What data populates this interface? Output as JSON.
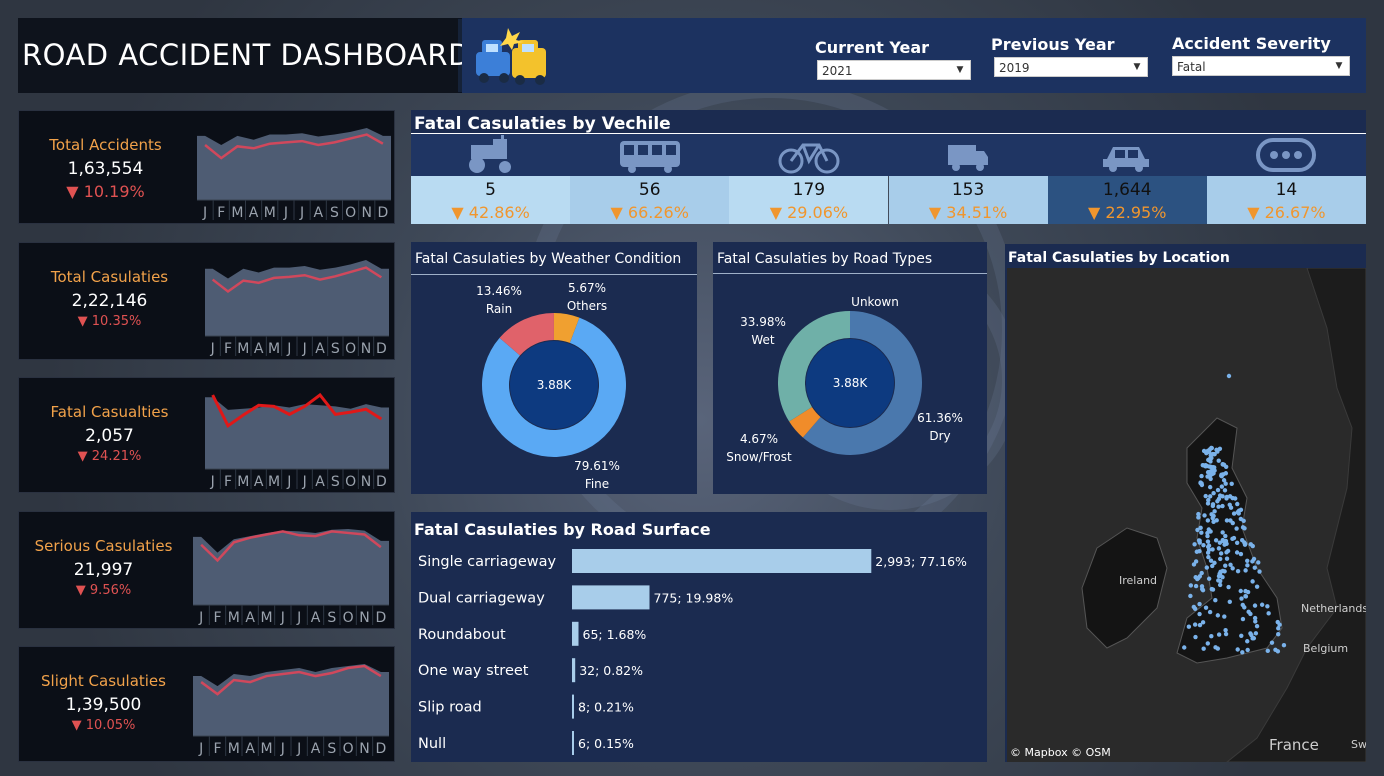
{
  "header": {
    "title": "ROAD ACCIDENT DASHBOARD",
    "filters": [
      {
        "label": "Current Year",
        "value": "2021"
      },
      {
        "label": "Previous Year",
        "value": "2019"
      },
      {
        "label": "Accident Severity",
        "value": "Fatal"
      }
    ]
  },
  "kpis": [
    {
      "label": "Total Accidents",
      "value": "1,63,554",
      "delta": "▼ 10.19%"
    },
    {
      "label": "Total Casulaties",
      "value": "2,22,146",
      "delta": "▼ 10.35%"
    },
    {
      "label": "Fatal Casualties",
      "value": "2,057",
      "delta": "▼ 24.21%"
    },
    {
      "label": "Serious Casulaties",
      "value": "21,997",
      "delta": "▼ 9.56%"
    },
    {
      "label": "Slight Casulaties",
      "value": "1,39,500",
      "delta": "▼ 10.05%"
    }
  ],
  "months": [
    "J",
    "F",
    "M",
    "A",
    "M",
    "J",
    "J",
    "A",
    "S",
    "O",
    "N",
    "D"
  ],
  "vehicle": {
    "title": "Fatal Casulaties by Vechile",
    "items": [
      {
        "icon": "tractor-icon",
        "value": "5",
        "delta": "▼ 42.86%"
      },
      {
        "icon": "bus-icon",
        "value": "56",
        "delta": "▼ 66.26%"
      },
      {
        "icon": "bicycle-icon",
        "value": "179",
        "delta": "▼ 29.06%"
      },
      {
        "icon": "van-icon",
        "value": "153",
        "delta": "▼ 34.51%"
      },
      {
        "icon": "car-icon",
        "value": "1,644",
        "delta": "▼ 22.95%"
      },
      {
        "icon": "other-icon",
        "value": "14",
        "delta": "▼ 26.67%"
      }
    ]
  },
  "weather": {
    "title": "Fatal Casulaties by Weather Condition",
    "center": "3.88K",
    "labels": [
      {
        "pct": "13.46%",
        "name": "Rain"
      },
      {
        "pct": "5.67%",
        "name": "Others"
      },
      {
        "pct": "79.61%",
        "name": "Fine"
      }
    ]
  },
  "road_types": {
    "title": "Fatal Casulaties by Road Types",
    "center": "3.88K",
    "labels": [
      {
        "pct": "",
        "name": "Unkown"
      },
      {
        "pct": "33.98%",
        "name": "Wet"
      },
      {
        "pct": "61.36%",
        "name": "Dry"
      },
      {
        "pct": "4.67%",
        "name": "Snow/Frost"
      }
    ]
  },
  "location": {
    "title": "Fatal Casulaties by Location",
    "map_labels": {
      "ireland": "Ireland",
      "netherlands": "Netherlands",
      "belgium": "Belgium",
      "france": "France",
      "sw": "Sw"
    },
    "credit": "© Mapbox © OSM"
  },
  "surface": {
    "title": "Fatal  Casulaties by Road Surface"
  },
  "chart_data": [
    {
      "type": "area",
      "title": "Total Accidents",
      "x": [
        "J",
        "F",
        "M",
        "A",
        "M",
        "J",
        "J",
        "A",
        "S",
        "O",
        "N",
        "D"
      ],
      "series": [
        {
          "name": "Current Year",
          "values": [
            13.0,
            11.0,
            12.8,
            12.5,
            13.2,
            13.4,
            13.6,
            13.0,
            13.4,
            14.0,
            14.6,
            13.2
          ]
        },
        {
          "name": "Previous Year",
          "values": [
            14.4,
            13.0,
            14.4,
            13.8,
            14.6,
            14.6,
            14.8,
            14.3,
            14.6,
            15.0,
            15.6,
            14.4
          ]
        }
      ]
    },
    {
      "type": "area",
      "title": "Total Casulaties",
      "x": [
        "J",
        "F",
        "M",
        "A",
        "M",
        "J",
        "J",
        "A",
        "S",
        "O",
        "N",
        "D"
      ],
      "series": [
        {
          "name": "Current Year",
          "values": [
            17.6,
            15.4,
            17.4,
            17.0,
            17.9,
            18.1,
            18.4,
            17.6,
            18.2,
            19.0,
            19.8,
            18.0
          ]
        },
        {
          "name": "Previous Year",
          "values": [
            19.6,
            17.8,
            19.6,
            18.9,
            19.8,
            19.8,
            20.1,
            19.4,
            19.8,
            20.4,
            21.2,
            19.6
          ]
        }
      ]
    },
    {
      "type": "area",
      "title": "Fatal Casualties",
      "x": [
        "J",
        "F",
        "M",
        "A",
        "M",
        "J",
        "J",
        "A",
        "S",
        "O",
        "N",
        "D"
      ],
      "series": [
        {
          "name": "Current Year",
          "values": [
            230,
            176,
            195,
            212,
            210,
            196,
            210,
            230,
            196,
            200,
            205,
            188
          ]
        },
        {
          "name": "Previous Year",
          "values": [
            226,
            204,
            206,
            208,
            212,
            208,
            214,
            212,
            210,
            206,
            214,
            208
          ]
        }
      ]
    },
    {
      "type": "area",
      "title": "Serious Casulaties",
      "x": [
        "J",
        "F",
        "M",
        "A",
        "M",
        "J",
        "J",
        "A",
        "S",
        "O",
        "N",
        "D"
      ],
      "series": [
        {
          "name": "Current Year",
          "values": [
            1.75,
            1.55,
            1.78,
            1.84,
            1.88,
            1.92,
            1.87,
            1.86,
            1.92,
            1.9,
            1.88,
            1.72
          ]
        },
        {
          "name": "Previous Year",
          "values": [
            1.85,
            1.65,
            1.82,
            1.86,
            1.9,
            1.93,
            1.92,
            1.9,
            1.94,
            1.95,
            1.93,
            1.8
          ]
        }
      ]
    },
    {
      "type": "area",
      "title": "Slight Casulaties",
      "x": [
        "J",
        "F",
        "M",
        "A",
        "M",
        "J",
        "J",
        "A",
        "S",
        "O",
        "N",
        "D"
      ],
      "series": [
        {
          "name": "Current Year",
          "values": [
            11.0,
            9.8,
            11.2,
            11.0,
            11.6,
            11.8,
            12.0,
            11.6,
            11.9,
            12.4,
            12.6,
            11.6
          ]
        },
        {
          "name": "Previous Year",
          "values": [
            11.6,
            10.6,
            11.8,
            11.6,
            12.0,
            12.2,
            12.4,
            12.0,
            12.4,
            12.6,
            12.8,
            12.0
          ]
        }
      ]
    },
    {
      "type": "pie",
      "title": "Fatal Casulaties by Weather Condition",
      "center_label": "3.88K",
      "categories": [
        "Fine",
        "Rain",
        "Others"
      ],
      "values": [
        79.61,
        13.46,
        5.67
      ],
      "colors": [
        "#5aa9f4",
        "#e0626a",
        "#f0a030"
      ]
    },
    {
      "type": "pie",
      "title": "Fatal Casulaties by Road Types",
      "center_label": "3.88K",
      "categories": [
        "Dry",
        "Snow/Frost",
        "Wet",
        "Unkown"
      ],
      "values": [
        61.36,
        4.67,
        33.98,
        0.0
      ],
      "colors": [
        "#4a78ad",
        "#f08c2a",
        "#6fb0a8",
        "#8fa8c8"
      ]
    },
    {
      "type": "bar",
      "title": "Fatal  Casulaties by Road Surface",
      "categories": [
        "Single carriageway",
        "Dual carriageway",
        "Roundabout",
        "One way street",
        "Slip road",
        "Null"
      ],
      "values": [
        2993,
        775,
        65,
        32,
        8,
        6
      ],
      "data_labels": [
        "2,993; 77.16%",
        "775; 19.98%",
        "65; 1.68%",
        "32; 0.82%",
        "8; 0.21%",
        "6; 0.15%"
      ],
      "xlim": [
        0,
        3000
      ]
    }
  ],
  "colors": {
    "orange": "#f2a24a",
    "red": "#e05252",
    "navy": "#1b2b50",
    "light_blue": "#a8cdea"
  }
}
